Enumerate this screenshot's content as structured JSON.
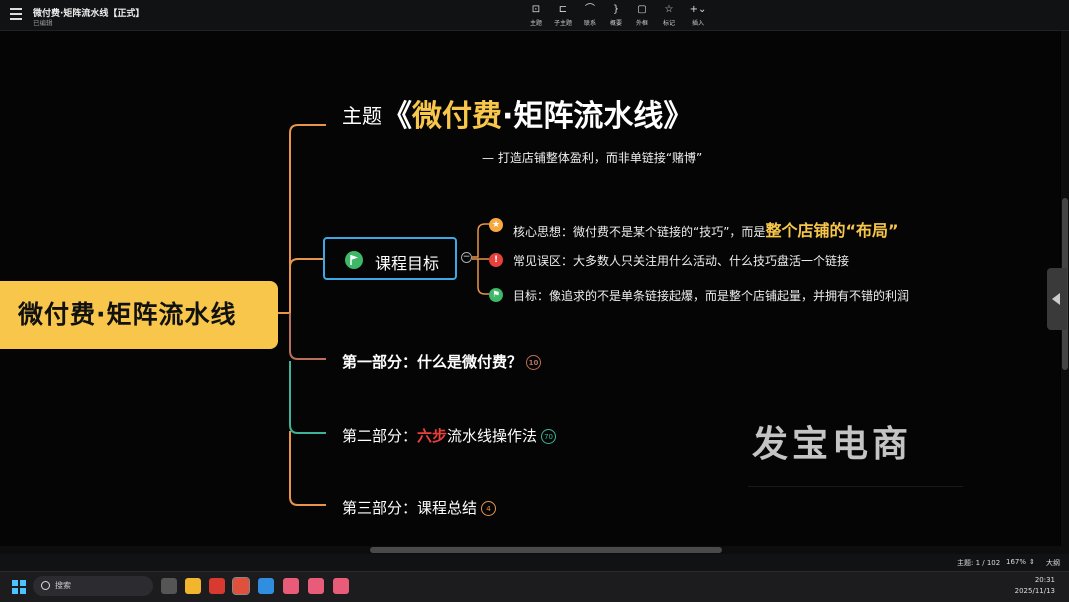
{
  "window": {
    "title": "微付费·矩阵流水线【正式】",
    "status": "已编辑"
  },
  "toolbar": [
    {
      "label": "主题",
      "icon": "topic-icon"
    },
    {
      "label": "子主题",
      "icon": "subtopic-icon"
    },
    {
      "label": "联系",
      "icon": "relationship-icon"
    },
    {
      "label": "概要",
      "icon": "summary-icon"
    },
    {
      "label": "外框",
      "icon": "boundary-icon"
    },
    {
      "label": "标记",
      "icon": "marker-icon"
    },
    {
      "label": "插入",
      "icon": "insert-icon"
    }
  ],
  "map": {
    "center": "微付费·矩阵流水线",
    "topic": {
      "prefix": "主题",
      "open": "《",
      "hl": "微付费",
      "rest": "·矩阵流水线",
      "close": "》"
    },
    "subtitle": "— 打造店铺整体盈利，而非单链接“赌博”",
    "goal": {
      "label": "课程目标",
      "children": [
        {
          "text": "核心思想：微付费不是某个链接的“技巧”，而是",
          "highlight": "整个店铺的“布局”",
          "icon": "star-icon",
          "color": "#f7a840"
        },
        {
          "text": "常见误区：大多数人只关注用什么活动、什么技巧盘活一个链接",
          "icon": "exclamation-icon",
          "color": "#e8403a"
        },
        {
          "text": "目标：像追求的不是单条链接起爆，而是整个店铺起量，并拥有不错的利润",
          "icon": "flag-icon",
          "color": "#3db869"
        }
      ]
    },
    "sections": [
      {
        "label": "第一部分：什么是微付费？",
        "count": "10",
        "color": "#b8705a"
      },
      {
        "pre": "第二部分：",
        "red": "六步",
        "post": "流水线操作法",
        "count": "70",
        "color": "#3fb39a"
      },
      {
        "label": "第三部分：课程总结",
        "count": "4",
        "color": "#e8954a"
      }
    ]
  },
  "watermark": "发宝电商",
  "statusbar": {
    "topic_count": "主题: 1 / 102",
    "zoom": "167%",
    "outline": "大纲"
  },
  "taskbar": {
    "search_placeholder": "搜索",
    "time": "20:31",
    "date": "2025/11/13"
  },
  "colors": {
    "accent_yellow": "#f7c64a",
    "goal_border": "#3fa7e4",
    "branch_orange": "#e8954a"
  }
}
